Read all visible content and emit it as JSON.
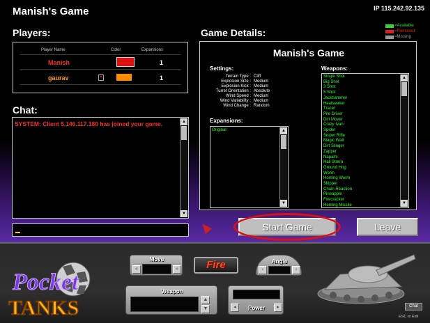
{
  "window": {
    "title": "Manish's Game",
    "ip": "IP  115.242.92.135"
  },
  "legend": [
    {
      "label": "=Available",
      "color": "#37d43a"
    },
    {
      "label": "=Removed",
      "color": "#e02020"
    },
    {
      "label": "=Missing",
      "color": "#9a9a9a"
    }
  ],
  "players": {
    "heading": "Players:",
    "columns": {
      "name": "Player Name",
      "color": "Color",
      "expansions": "Expansions"
    },
    "rows": [
      {
        "name": "Manish",
        "name_color": "#ff2a2a",
        "tank_color": "#e01010",
        "expansions": "1"
      },
      {
        "name": "gaurav",
        "name_color": "#ff9a1a",
        "tank_color": "#ff8c00",
        "expansions": "1"
      }
    ],
    "kick_icon": "x-box-icon"
  },
  "chat": {
    "heading": "Chat:",
    "message": "SYSTEM: Client 5.146.117.180 has joined your game.",
    "message_color": "#ff2a2a",
    "input_value": ""
  },
  "details": {
    "heading": "Game Details:",
    "game_name": "Manish's Game",
    "settings_heading": "Settings:",
    "settings": [
      {
        "label": "Terrain Type :",
        "value": "Cliff"
      },
      {
        "label": "Explosion Size :",
        "value": "Medium"
      },
      {
        "label": "Explosion Kick :",
        "value": "Medium"
      },
      {
        "label": "Turret Orientation :",
        "value": "Absolute"
      },
      {
        "label": "Wind Speed :",
        "value": "Medium"
      },
      {
        "label": "Wind Variability :",
        "value": "Medium"
      },
      {
        "label": "Wind Change :",
        "value": "Random"
      }
    ],
    "expansions_heading": "Expansions:",
    "expansions": [
      "Original"
    ],
    "weapons_heading": "Weapons:",
    "weapons": [
      "Single Shot",
      "Big Shot",
      "3 Shot",
      "5 Shot",
      "Jackhammer",
      "Heatseeker",
      "Tracer",
      "Pile Driver",
      "Dirt Mover",
      "Crazy Ivan",
      "Spider",
      "Sniper Rifle",
      "Magic Wall",
      "Dirt Slinger",
      "Zapper",
      "Napalm",
      "Hail Storm",
      "Ground Hog",
      "Worm",
      "Homing Worm",
      "Skipper",
      "Chain Reaction",
      "Pineapple",
      "Firecracker",
      "Homing Missile",
      "Dirtball",
      "Tommy Gun",
      "Mountain Mover"
    ]
  },
  "buttons": {
    "start": "Start Game",
    "leave": "Leave"
  },
  "controls": {
    "logo_top": "Pocket",
    "logo_bottom": "TANKS",
    "move": "Move",
    "fire": "Fire",
    "angle": "Angle",
    "weapon": "Weapon",
    "power": "Power",
    "chat": "Chat",
    "esc": "ESC to Exit"
  },
  "colors": {
    "accent_purple": "#5a2aa3",
    "fire_orange": "#ff4a1a",
    "weapon_green": "#33ff33"
  }
}
